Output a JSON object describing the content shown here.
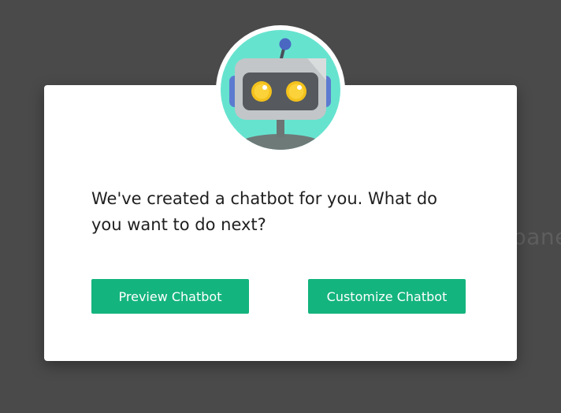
{
  "backdrop": {
    "partial_text": "pane"
  },
  "modal": {
    "avatar_icon": "robot-icon",
    "message": "We've created a chatbot for you. What do you want to do next?",
    "buttons": {
      "preview_label": "Preview Chatbot",
      "customize_label": "Customize Chatbot"
    }
  },
  "colors": {
    "backdrop": "#4a4a4a",
    "button": "#14b47e",
    "avatar_bg": "#66e3cf"
  }
}
